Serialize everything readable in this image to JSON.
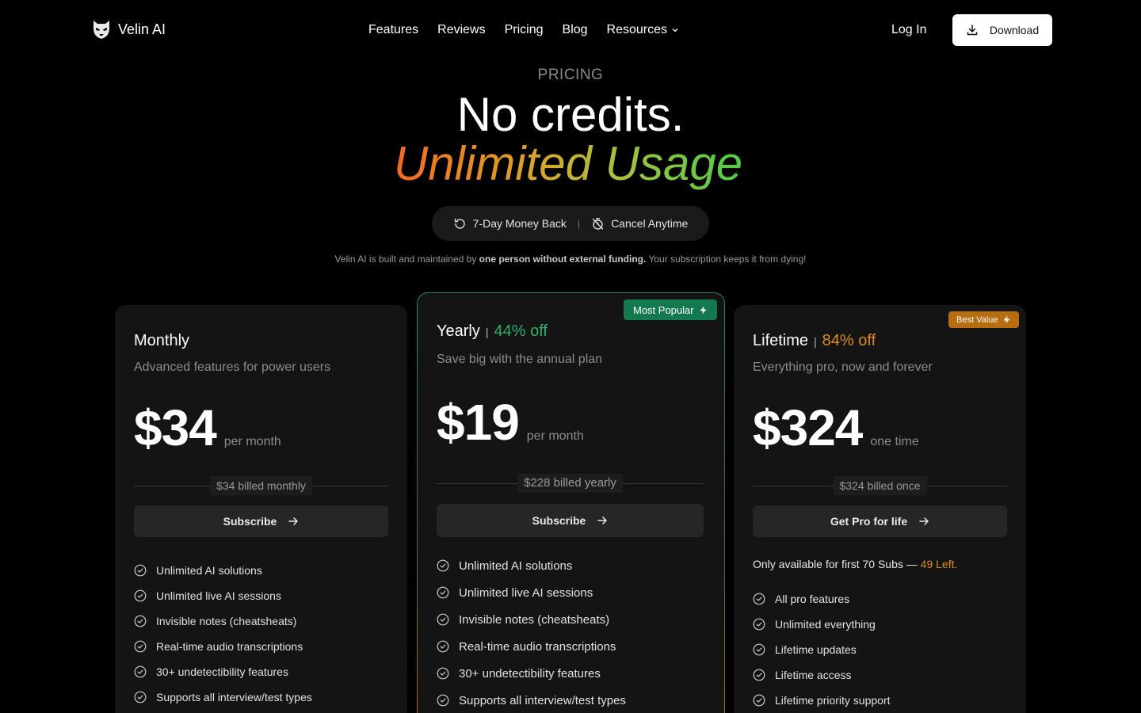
{
  "nav": {
    "brand": "Velin AI",
    "links": [
      "Features",
      "Reviews",
      "Pricing",
      "Blog",
      "Resources"
    ],
    "login": "Log In",
    "download": "Download"
  },
  "hero": {
    "eyebrow": "PRICING",
    "headline": "No credits.",
    "headline_gradient": "Unlimited Usage",
    "guarantee_1": "7-Day Money Back",
    "guarantee_sep": "|",
    "guarantee_2": "Cancel Anytime",
    "note_prefix": "Velin AI is built and maintained by ",
    "note_bold": "one person without external funding.",
    "note_suffix": " Your subscription keeps it from dying!"
  },
  "plans": {
    "monthly": {
      "title": "Monthly",
      "desc": "Advanced features for power users",
      "price": "$34",
      "unit": "per month",
      "billed": "$34 billed monthly",
      "cta": "Subscribe",
      "features": [
        "Unlimited AI solutions",
        "Unlimited live AI sessions",
        "Invisible notes (cheatsheats)",
        "Real-time audio transcriptions",
        "30+ undetectibility features",
        "Supports all interview/test types"
      ]
    },
    "yearly": {
      "badge": "Most Popular",
      "title": "Yearly",
      "sep": "|",
      "discount": "44% off",
      "desc": "Save big with the annual plan",
      "price": "$19",
      "unit": "per month",
      "billed": "$228 billed yearly",
      "cta": "Subscribe",
      "features": [
        "Unlimited AI solutions",
        "Unlimited live AI sessions",
        "Invisible notes (cheatsheats)",
        "Real-time audio transcriptions",
        "30+ undetectibility features",
        "Supports all interview/test types"
      ]
    },
    "lifetime": {
      "badge": "Best Value",
      "title": "Lifetime",
      "sep": "|",
      "discount": "84% off",
      "desc": "Everything pro, now and forever",
      "price": "$324",
      "unit": "one time",
      "billed": "$324 billed once",
      "cta": "Get Pro for life",
      "availability": "Only available for first 70 Subs — ",
      "availability_left": "49 Left.",
      "features": [
        "All pro features",
        "Unlimited everything",
        "Lifetime updates",
        "Lifetime access",
        "Lifetime priority support"
      ]
    }
  }
}
